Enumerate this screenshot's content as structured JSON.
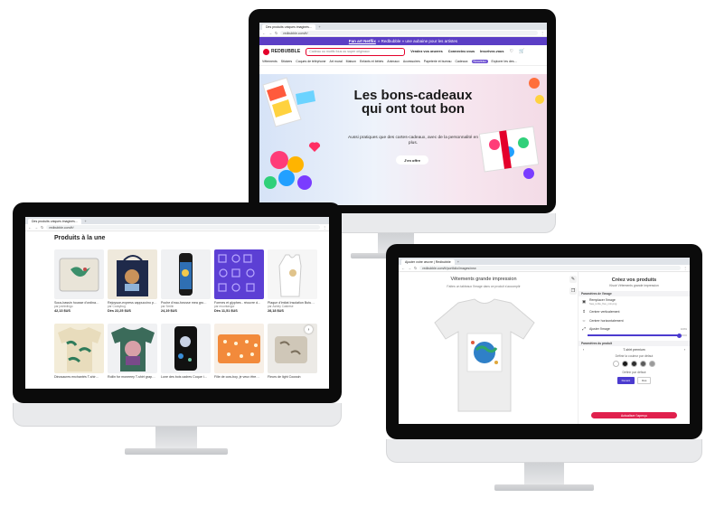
{
  "monitor_home": {
    "tab_title": "Des produits uniques imaginés…",
    "url": "redbubble.com/fr/",
    "promo": {
      "link": "Fan art Netflix",
      "text": "» Redbubble » une aubaine pour les artistes"
    },
    "logo": "REDBUBBLE",
    "search_placeholder": "Cadeau ou motifs fous ou super originaux",
    "nav": [
      "Vendez vos œuvres",
      "Connectez-vous",
      "Inscrivez-vous"
    ],
    "categories": [
      "Vêtements",
      "Stickers",
      "Coques de téléphone",
      "Art mural",
      "Maison",
      "Enfants et bébés",
      "Animaux",
      "Accessoires",
      "Papeterie et bureau",
      "Cadeaux",
      "Explorer les des…"
    ],
    "category_badge": "Nouveau",
    "hero": {
      "title": "Les bons-cadeaux qui ont tout bon",
      "subtitle": "Aussi pratiques que des cartes-cadeaux, avec de la personnalité en plus.",
      "button": "J'en offre"
    }
  },
  "monitor_products": {
    "tab_title": "Des produits uniques imaginés…",
    "url": "redbubble.com/fr/",
    "section_title": "Produits à la une",
    "products": [
      {
        "title": "Sous-bassin housse d'ordina…",
        "by": "par joshinlingo",
        "price": "42,13 $US"
      },
      {
        "title": "Rejoysue-express cappuccino p…",
        "by": "par Cookybug",
        "price": "Dès 22,25 $US"
      },
      {
        "title": "Poche d'eau-forusse mea gro…",
        "by": "par Smilin",
        "price": "24,19 $US"
      },
      {
        "title": "Formes et glyphes - réouvre d…",
        "by": "par muuntangor",
        "price": "Dès 11,51 $US"
      },
      {
        "title": "Plaque d'imitat Insolation Butu…",
        "by": "par Ashley Castrese",
        "price": "28,18 $US"
      },
      {
        "title": "Dinosaures enchantés T-shir…",
        "by": "",
        "price": ""
      },
      {
        "title": "Rollin for moneeey T-shirt grap…",
        "by": "",
        "price": ""
      },
      {
        "title": "Lune des bois cadres Coque i…",
        "by": "",
        "price": ""
      },
      {
        "title": "Fille de cow-boy, je veux être…",
        "by": "",
        "price": ""
      },
      {
        "title": "Fleurs de light Coussin",
        "by": "",
        "price": ""
      }
    ],
    "next_icon": "›"
  },
  "monitor_editor": {
    "tab_title": "Ajouter votre œuvre | Redbubble",
    "url": "redbubble.com/fr/portfolio/images/new",
    "canvas_title": "Vêtements grande impression",
    "canvas_subtitle": "Faites un tableaux l'image dans ce produit s'accomplir",
    "panel": {
      "title": "Créez vos produits",
      "subtitle": "Kisoir Vêtements grande impression",
      "section_image": "Paramètres de l'image",
      "options": [
        {
          "label": "Remplacer l'image",
          "hint": "Sea_turtle_fluo_min.png"
        },
        {
          "label": "Centrer verticalement",
          "hint": ""
        },
        {
          "label": "Centrer horizontalement",
          "hint": ""
        }
      ],
      "resize_label": "Ajuster l'image",
      "resize_value": "100%",
      "resize_fraction": 0.92,
      "section_product": "Paramètres du produit",
      "size_label": "T-shirt premium",
      "color_label": "Définir la couleur par défaut",
      "swatches": [
        "#ffffff",
        "#1a1a1a",
        "#2d2d2d",
        "#5a5a5a",
        "#9a9a9a"
      ],
      "default_label": "Définir par défaut",
      "default_options": [
        "Devant",
        "Dos"
      ],
      "add_button": "Actualiser l'aperçu"
    }
  }
}
